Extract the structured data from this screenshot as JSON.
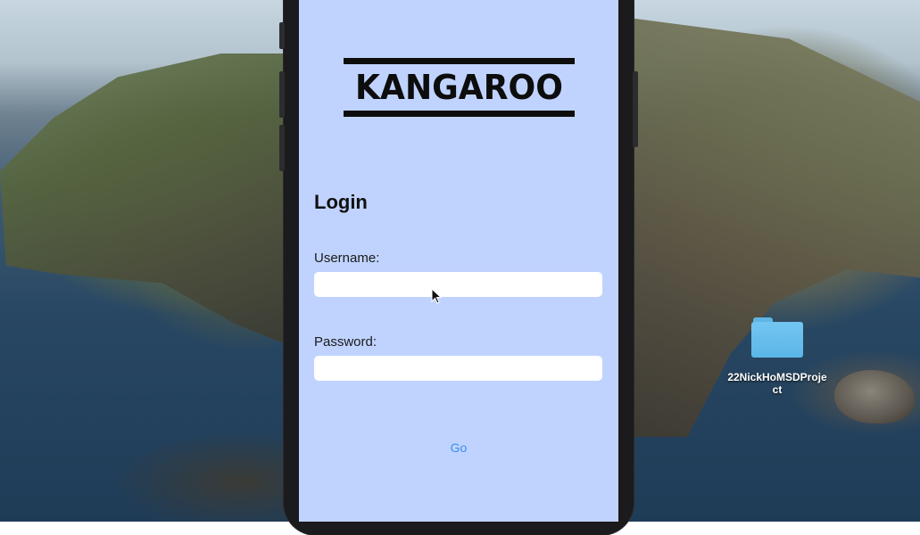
{
  "app": {
    "logo_text": "KANGAROO",
    "title": "Login",
    "username": {
      "label": "Username:",
      "value": "",
      "placeholder": ""
    },
    "password": {
      "label": "Password:",
      "value": "",
      "placeholder": ""
    },
    "go_label": "Go",
    "colors": {
      "background": "#c0d3ff",
      "accent": "#3a8ef0",
      "logo": "#0d0d0d"
    }
  },
  "desktop": {
    "folder_name": "22NickHoMSDProject",
    "folder_icon": "folder-icon"
  },
  "cursor": {
    "icon": "arrow-pointer-icon"
  }
}
